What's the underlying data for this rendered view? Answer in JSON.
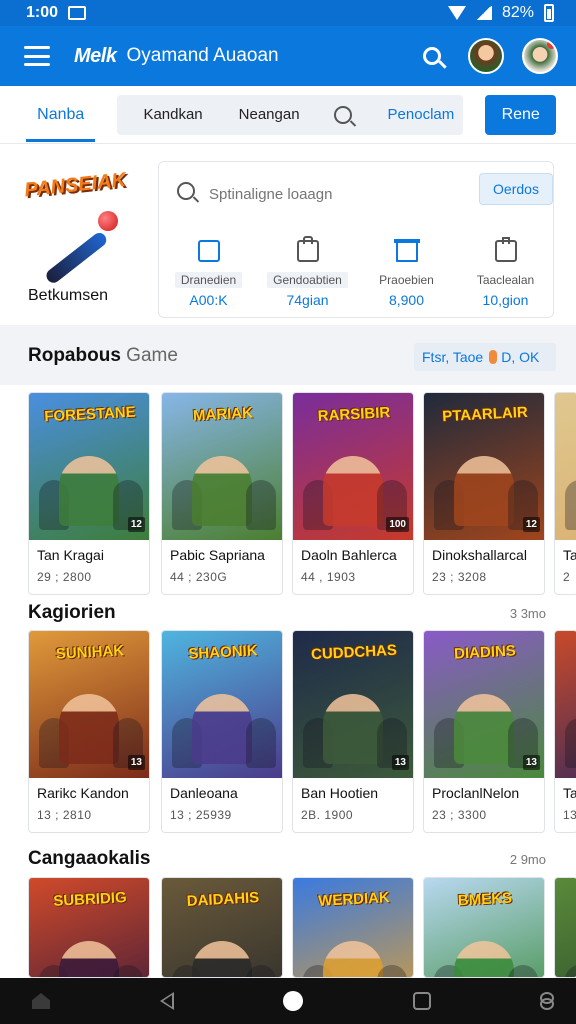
{
  "status_bar": {
    "time": "1:00",
    "battery": "82%"
  },
  "app_bar": {
    "logo": "Melk",
    "logo_sub": "",
    "title": "Oyamand Auaoan"
  },
  "tabs": {
    "active": "Nanba",
    "segment": [
      "Kandkan",
      "Neangan"
    ],
    "link": "Penoclam",
    "primary_button": "Rene"
  },
  "promo": {
    "logo_text": "PANSEIAK",
    "caption": "Betkumsen",
    "search_placeholder": "Sptinaligne loaagn",
    "chip": "Oerdos",
    "stats": [
      {
        "icon": "tablet-icon",
        "label": "Dranedien",
        "value": "A00:K"
      },
      {
        "icon": "briefcase-icon",
        "label": "Gendoabtien",
        "value": "74gian"
      },
      {
        "icon": "box-icon",
        "label": "Praoebien",
        "value": "8,900"
      },
      {
        "icon": "shopping-bag-icon",
        "label": "Taaclealan",
        "value": "10,gion"
      }
    ]
  },
  "sections": [
    {
      "title": "Ropabous",
      "title_suffix": "Game",
      "filter_label": "Ftsr, Taoe",
      "filter_suffix": "D, OK",
      "games": [
        {
          "logo": "FORESTANE",
          "title": "Tan Kragai",
          "meta": "29 ; 2800",
          "rating": "12",
          "palette": [
            "#4a8fe0",
            "#3d7d3a"
          ]
        },
        {
          "logo": "MARIAK",
          "title": "Pabic Sapriana",
          "meta": "44 ; 230G",
          "rating": "",
          "palette": [
            "#87b6e8",
            "#4b7e2e"
          ]
        },
        {
          "logo": "RARSIBIR",
          "title": "Daoln Bahlerca",
          "meta": "44 , 1903",
          "rating": "100",
          "palette": [
            "#7a2d9c",
            "#c73a2a"
          ]
        },
        {
          "logo": "PTAARLAIR",
          "title": "Dinokshallarcal",
          "meta": "23 ; 3208",
          "rating": "12",
          "palette": [
            "#202a3c",
            "#a0451c"
          ]
        },
        {
          "logo": "",
          "title": "Ta",
          "meta": "2",
          "rating": "",
          "palette": [
            "#e0c890",
            "#d9b070"
          ]
        }
      ]
    },
    {
      "title": "Kagiorien",
      "title_suffix": "",
      "more": "3 3mo",
      "games": [
        {
          "logo": "SUNIHAK",
          "title": "Rarikc Kandon",
          "meta": "13 ; 2810",
          "rating": "13",
          "palette": [
            "#e09a3a",
            "#7c2a1a"
          ]
        },
        {
          "logo": "SHAONIK",
          "title": "Danleoana",
          "meta": "13 ; 25939",
          "rating": "",
          "palette": [
            "#4fb5e0",
            "#4b3a8a"
          ]
        },
        {
          "logo": "CUDDCHAS",
          "title": "Ban Hootien",
          "meta": "2B. 1900",
          "rating": "13",
          "palette": [
            "#1e2a4a",
            "#3d5a3a"
          ]
        },
        {
          "logo": "DIADINS",
          "title": "ProclanlNelon",
          "meta": "23 ; 3300",
          "rating": "13",
          "palette": [
            "#8a5ac8",
            "#4a8a3a"
          ]
        },
        {
          "logo": "",
          "title": "Ta",
          "meta": "13",
          "rating": "",
          "palette": [
            "#c84a2a",
            "#3a2a5a"
          ]
        }
      ]
    },
    {
      "title": "Cangaaokalis",
      "title_suffix": "",
      "more": "2 9mo",
      "games": [
        {
          "logo": "SUBRIDIG",
          "title": "",
          "meta": "",
          "rating": "",
          "palette": [
            "#d04a2a",
            "#3a1a3a"
          ]
        },
        {
          "logo": "DAIDAHIS",
          "title": "",
          "meta": "",
          "rating": "",
          "palette": [
            "#6a5a3a",
            "#2a2a2a"
          ]
        },
        {
          "logo": "WERDIAK",
          "title": "",
          "meta": "",
          "rating": "",
          "palette": [
            "#3a7ae0",
            "#e0a030"
          ]
        },
        {
          "logo": "BMEKS",
          "title": "",
          "meta": "",
          "rating": "",
          "palette": [
            "#b8d8f0",
            "#3a8a3a"
          ]
        },
        {
          "logo": "",
          "title": "",
          "meta": "",
          "rating": "",
          "palette": [
            "#5a8a3a",
            "#2a4a2a"
          ]
        }
      ]
    }
  ]
}
